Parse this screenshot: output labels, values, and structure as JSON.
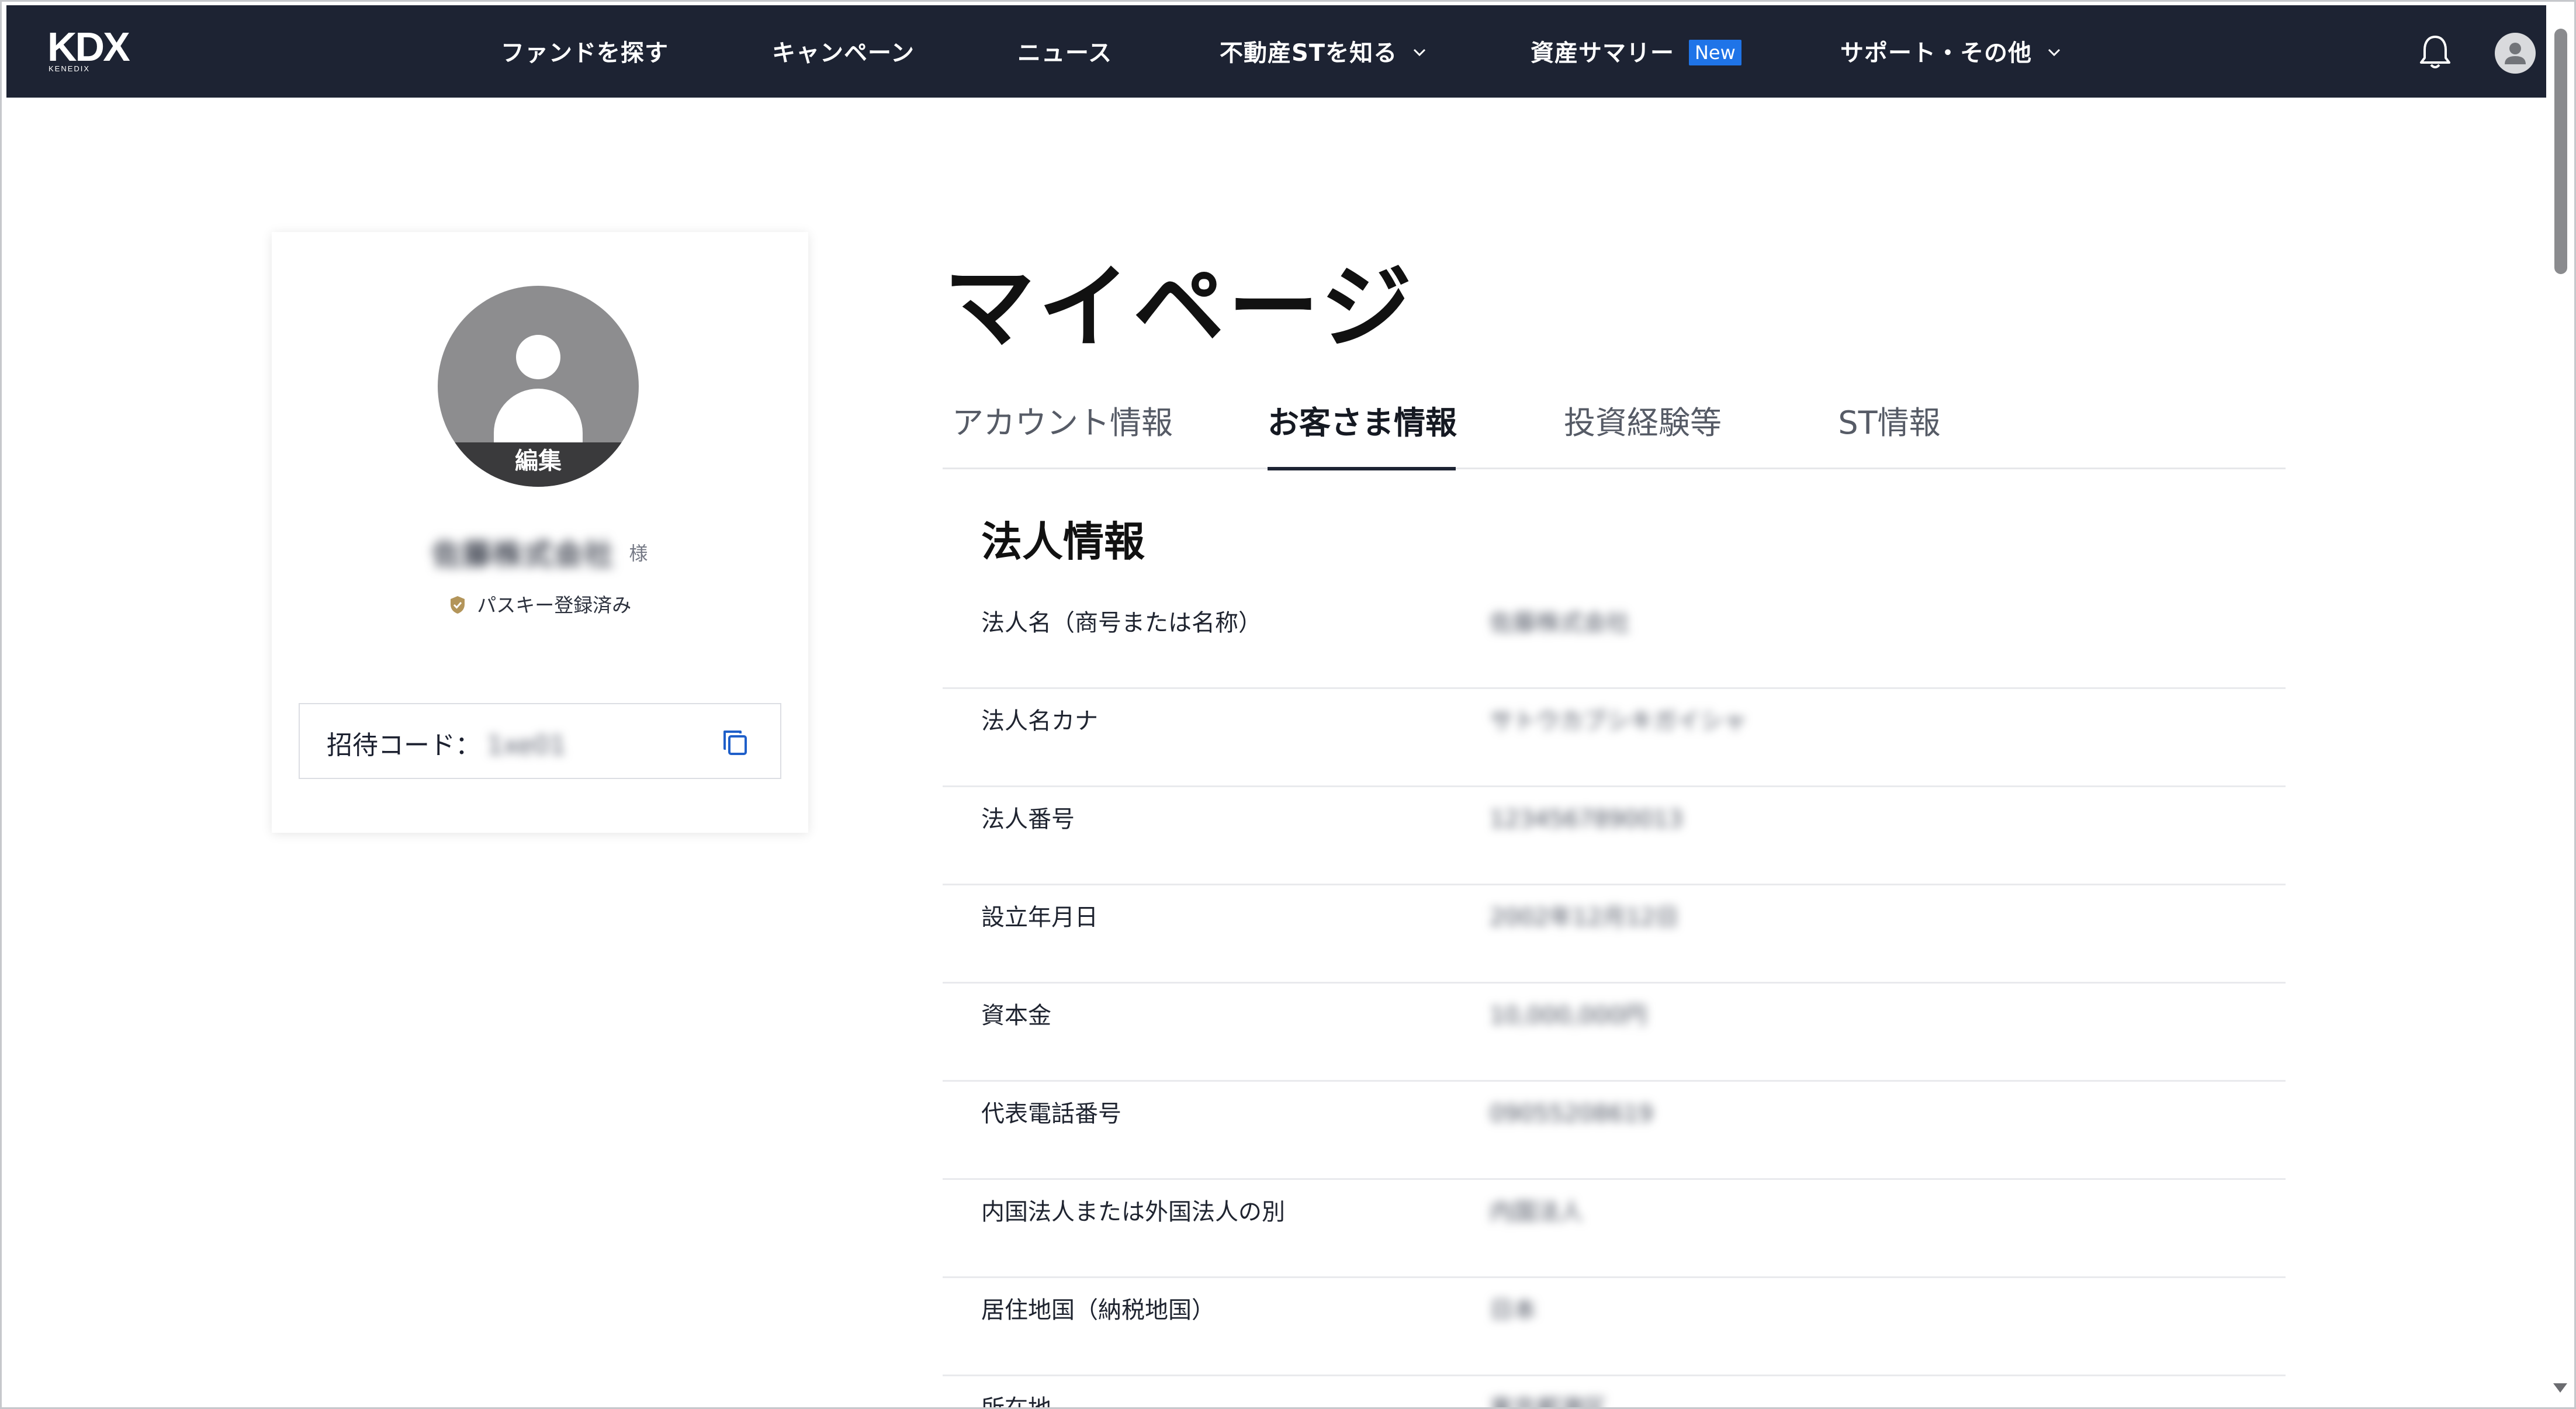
{
  "brand": {
    "name": "KDX",
    "sub": "KENEDIX"
  },
  "nav": {
    "items": [
      {
        "label": "ファンドを探す"
      },
      {
        "label": "キャンペーン"
      },
      {
        "label": "ニュース"
      },
      {
        "label": "不動産STを知る",
        "icon": "chevron-down-icon"
      },
      {
        "label": "資産サマリー",
        "badge": "New"
      },
      {
        "label": "サポート・その他",
        "icon": "chevron-down-icon"
      }
    ],
    "right_icons": [
      "bell-icon",
      "user-avatar-icon"
    ]
  },
  "profile": {
    "edit_label": "編集",
    "name": "佐藤株式会社",
    "honorific": "様",
    "passkey_status": "パスキー登録済み",
    "invite_label": "招待コード：",
    "invite_code": "1xe01",
    "copy_icon": "copy-icon"
  },
  "page": {
    "title": "マイページ",
    "tabs": [
      {
        "label": "アカウント情報",
        "active": false
      },
      {
        "label": "お客さま情報",
        "active": true
      },
      {
        "label": "投資経験等",
        "active": false
      },
      {
        "label": "ST情報",
        "active": false
      }
    ]
  },
  "corporate": {
    "section_title": "法人情報",
    "rows": [
      {
        "label": "法人名（商号または名称）",
        "value": "佐藤株式会社"
      },
      {
        "label": "法人名カナ",
        "value": "サトウカブシキガイシャ"
      },
      {
        "label": "法人番号",
        "value": "1234567890013"
      },
      {
        "label": "設立年月日",
        "value": "2002年12月12日"
      },
      {
        "label": "資本金",
        "value": "10,000,000円"
      },
      {
        "label": "代表電話番号",
        "value": "09055208619"
      },
      {
        "label": "内国法人または外国法人の別",
        "value": "内国法人"
      },
      {
        "label": "居住地国（納税地国）",
        "value": "日本"
      },
      {
        "label": "所在地",
        "value": "東京都港区"
      }
    ]
  },
  "colors": {
    "nav_bg": "#1d2333",
    "badge_new": "#1f74e8",
    "copy_icon": "#1f5fc9",
    "passkey_shield": "#b3955a"
  }
}
